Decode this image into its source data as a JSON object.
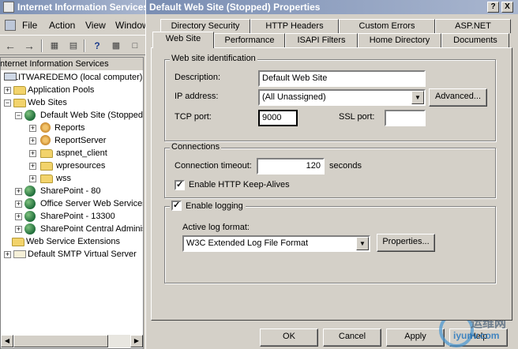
{
  "iis": {
    "title": "Internet Information Services",
    "menu": {
      "file": "File",
      "action": "Action",
      "view": "View",
      "window": "Window"
    },
    "tree": {
      "root": "Internet Information Services",
      "computer": "LITWAREDEMO (local computer)",
      "app_pools": "Application Pools",
      "web_sites": "Web Sites",
      "default_site": "Default Web Site (Stopped)",
      "reports": "Reports",
      "report_server": "ReportServer",
      "aspnet_client": "aspnet_client",
      "wpresources": "wpresources",
      "wss": "wss",
      "sp80": "SharePoint - 80",
      "office_server": "Office Server Web Services",
      "sp13300": "SharePoint - 13300",
      "sp_central": "SharePoint Central Administration",
      "web_service_ext": "Web Service Extensions",
      "smtp": "Default SMTP Virtual Server"
    }
  },
  "dialog": {
    "title": "Default Web Site (Stopped) Properties",
    "caption_help": "?",
    "caption_close": "X",
    "tabs_row1": [
      "Directory Security",
      "HTTP Headers",
      "Custom Errors",
      "ASP.NET"
    ],
    "tabs_row2": [
      "Web Site",
      "Performance",
      "ISAPI Filters",
      "Home Directory",
      "Documents"
    ],
    "identification": {
      "group_title": "Web site identification",
      "description_label": "Description:",
      "description_value": "Default Web Site",
      "ip_label": "IP address:",
      "ip_value": "(All Unassigned)",
      "advanced_button": "Advanced...",
      "tcp_label": "TCP port:",
      "tcp_value": "9000",
      "ssl_label": "SSL port:",
      "ssl_value": ""
    },
    "connections": {
      "group_title": "Connections",
      "timeout_label": "Connection timeout:",
      "timeout_value": "120",
      "timeout_unit": "seconds",
      "keepalive_label": "Enable HTTP Keep-Alives",
      "keepalive_checked": true
    },
    "logging": {
      "enable_label": "Enable logging",
      "enable_checked": true,
      "format_label": "Active log format:",
      "format_value": "W3C Extended Log File Format",
      "properties_button": "Properties..."
    },
    "buttons": {
      "ok": "OK",
      "cancel": "Cancel",
      "apply": "Apply",
      "help": "Help"
    }
  },
  "watermark": {
    "cn": "运维网",
    "en": "iyunv.com"
  },
  "icons": {
    "back": "back-arrow-icon",
    "forward": "forward-arrow-icon",
    "help": "help-icon",
    "folder": "folder-icon",
    "globe": "globe-icon",
    "gear": "gear-icon",
    "computer": "computer-icon"
  },
  "colors": {
    "titlebar_start": "#7a8eb3",
    "titlebar_end": "#a9b6cf",
    "face": "#d4d0c8"
  }
}
